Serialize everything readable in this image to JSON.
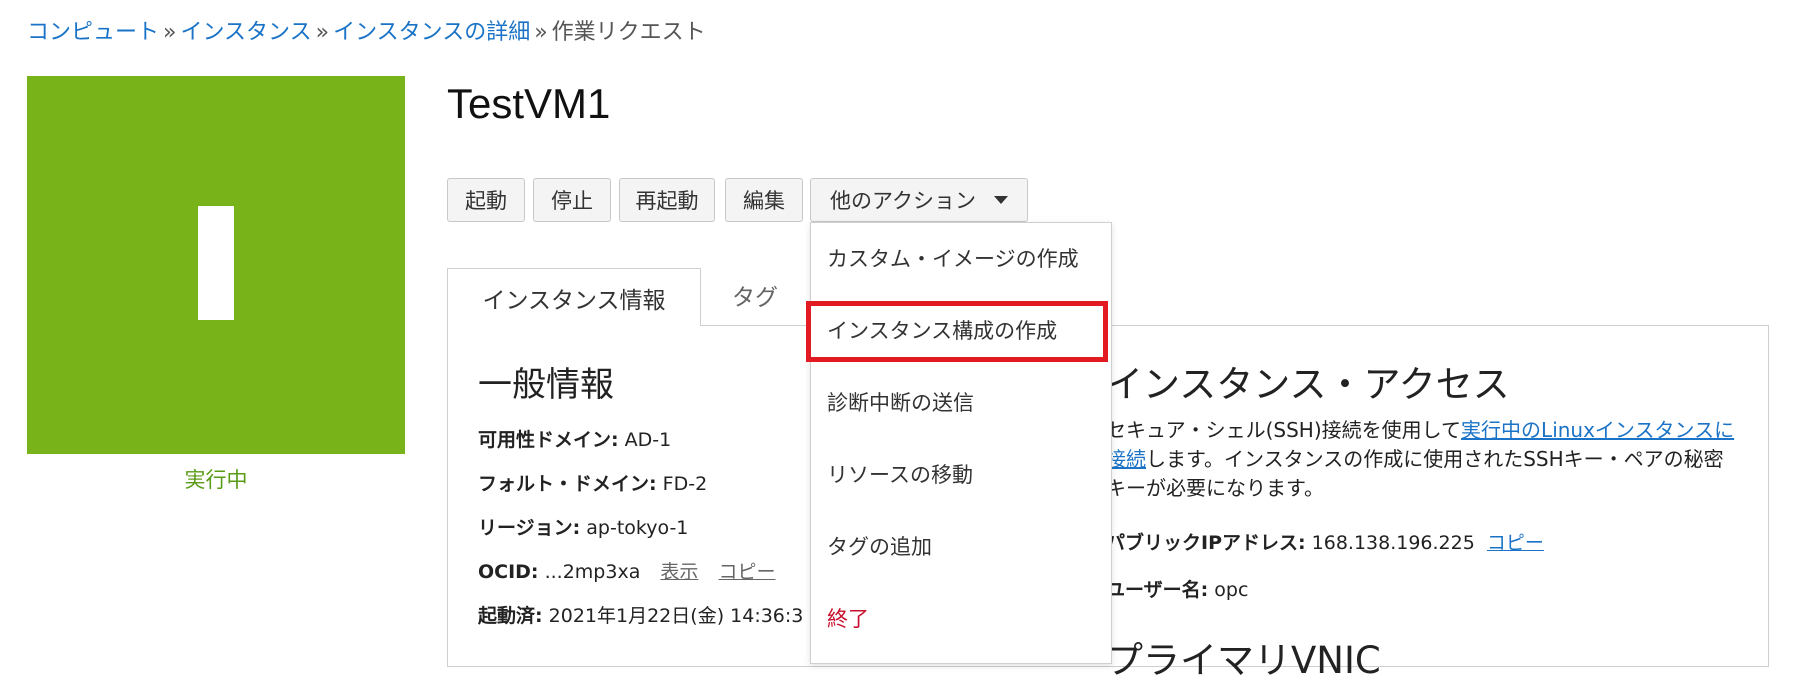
{
  "breadcrumb": {
    "items": [
      "コンピュート",
      "インスタンス",
      "インスタンスの詳細"
    ],
    "separator": "»",
    "current": "作業リクエスト"
  },
  "instance": {
    "name": "TestVM1",
    "status": "実行中",
    "status_color": "#78b419"
  },
  "actions": {
    "start": "起動",
    "stop": "停止",
    "reboot": "再起動",
    "edit": "編集",
    "more": "他のアクション"
  },
  "more_menu": {
    "items": [
      "カスタム・イメージの作成",
      "インスタンス構成の作成",
      "診断中断の送信",
      "リソースの移動",
      "タグの追加",
      "終了"
    ],
    "highlighted_index": 1
  },
  "tabs": {
    "active": "インスタンス情報",
    "other": "タグ"
  },
  "general_info": {
    "heading": "一般情報",
    "availability_domain_label": "可用性ドメイン:",
    "availability_domain": "AD-1",
    "fault_domain_label": "フォルト・ドメイン:",
    "fault_domain": "FD-2",
    "region_label": "リージョン:",
    "region": "ap-tokyo-1",
    "ocid_label": "OCID:",
    "ocid": "...2mp3xa",
    "show": "表示",
    "copy": "コピー",
    "launched_label": "起動済:",
    "launched": "2021年1月22日(金) 14:36:3"
  },
  "instance_access": {
    "heading": "インスタンス・アクセス",
    "text_before": "セキュア・シェル(SSH)接続を使用して",
    "link_text": "実行中のLinuxインスタンスに接続",
    "text_after": "します。インスタンスの作成に使用されたSSHキー・ペアの秘密キーが必要になります。",
    "public_ip_label": "パブリックIPアドレス:",
    "public_ip": "168.138.196.225",
    "copy": "コピー",
    "username_label": "ユーザー名:",
    "username": "opc",
    "vnic_heading": "プライマリVNIC"
  }
}
